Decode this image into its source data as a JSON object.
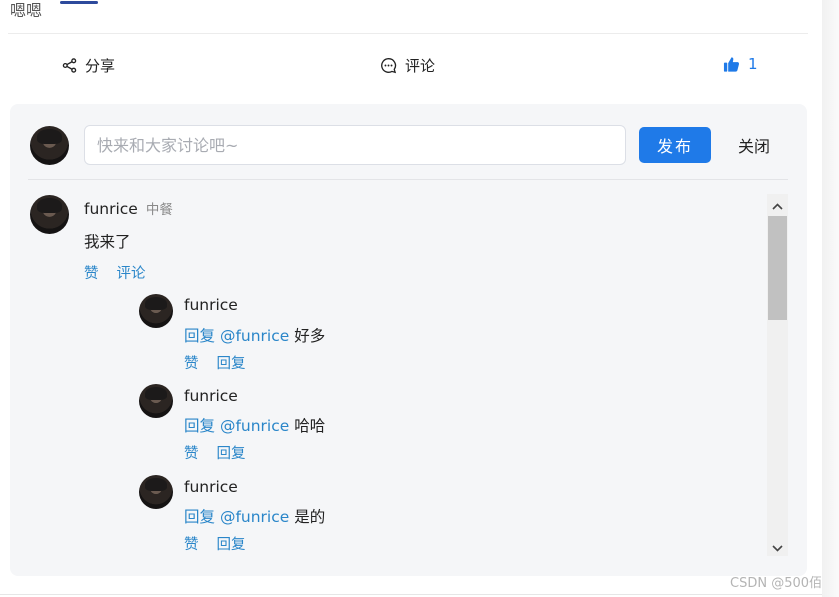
{
  "header": {
    "tab_title": "嗯嗯"
  },
  "actions": {
    "share_label": "分享",
    "comment_label": "评论",
    "like_count": "1"
  },
  "composer": {
    "placeholder": "快来和大家讨论吧~",
    "publish_label": "发布",
    "close_label": "关闭"
  },
  "comment": {
    "author": "funrice",
    "tag": "中餐",
    "text": "我来了",
    "like_label": "赞",
    "comment_label": "评论"
  },
  "replies": [
    {
      "author": "funrice",
      "reply_prefix": "回复",
      "mention": "@funrice",
      "text": "好多",
      "like_label": "赞",
      "reply_label": "回复"
    },
    {
      "author": "funrice",
      "reply_prefix": "回复",
      "mention": "@funrice",
      "text": "哈哈",
      "like_label": "赞",
      "reply_label": "回复"
    },
    {
      "author": "funrice",
      "reply_prefix": "回复",
      "mention": "@funrice",
      "text": "是的",
      "like_label": "赞",
      "reply_label": "回复"
    }
  ],
  "watermark": "CSDN @500佰",
  "colors": {
    "accent": "#1f7ae8",
    "link": "#2a86c9",
    "panel_bg": "#f5f6f8"
  },
  "icons": {
    "share": "share-icon",
    "comment": "comment-bubble-icon",
    "like": "thumbs-up-icon"
  }
}
